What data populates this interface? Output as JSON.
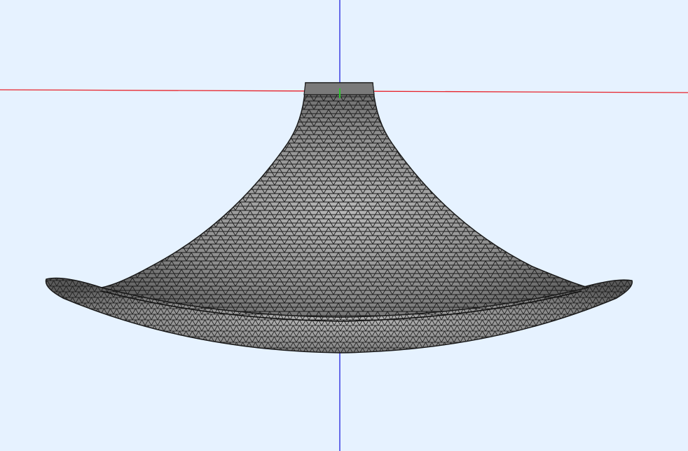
{
  "viewport": {
    "background_color": "#e6f2ff",
    "render_mode": "wireframe-shaded",
    "mesh": {
      "name": "horn-mesh",
      "fill_color": "#8f8f8f",
      "edge_color": "#1a1a1a",
      "element_type": "triangle"
    },
    "axes": {
      "x_color": "#e8232a",
      "y_color": "#2ec52e",
      "z_color": "#2222dd"
    }
  }
}
